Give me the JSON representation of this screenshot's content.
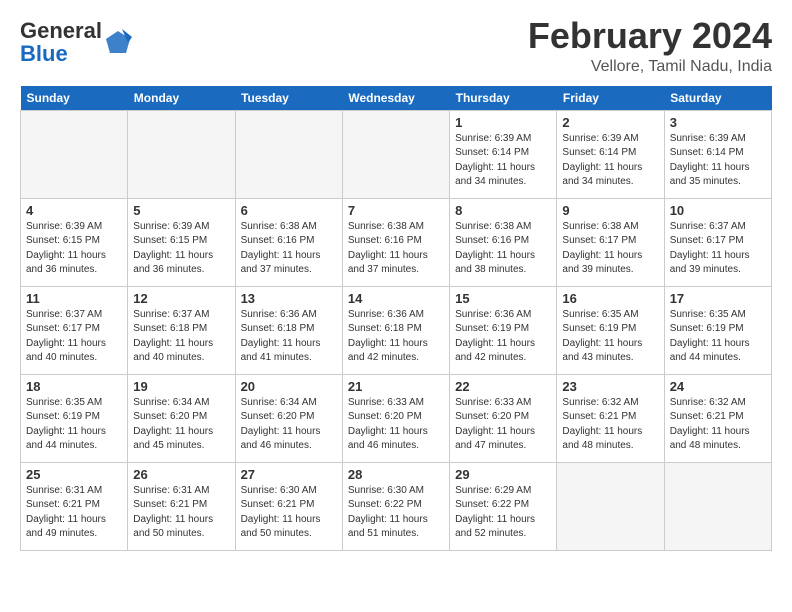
{
  "header": {
    "logo_general": "General",
    "logo_blue": "Blue",
    "title": "February 2024",
    "subtitle": "Vellore, Tamil Nadu, India"
  },
  "calendar": {
    "days_of_week": [
      "Sunday",
      "Monday",
      "Tuesday",
      "Wednesday",
      "Thursday",
      "Friday",
      "Saturday"
    ],
    "weeks": [
      [
        {
          "day": "",
          "info": ""
        },
        {
          "day": "",
          "info": ""
        },
        {
          "day": "",
          "info": ""
        },
        {
          "day": "",
          "info": ""
        },
        {
          "day": "1",
          "info": "Sunrise: 6:39 AM\nSunset: 6:14 PM\nDaylight: 11 hours\nand 34 minutes."
        },
        {
          "day": "2",
          "info": "Sunrise: 6:39 AM\nSunset: 6:14 PM\nDaylight: 11 hours\nand 34 minutes."
        },
        {
          "day": "3",
          "info": "Sunrise: 6:39 AM\nSunset: 6:14 PM\nDaylight: 11 hours\nand 35 minutes."
        }
      ],
      [
        {
          "day": "4",
          "info": "Sunrise: 6:39 AM\nSunset: 6:15 PM\nDaylight: 11 hours\nand 36 minutes."
        },
        {
          "day": "5",
          "info": "Sunrise: 6:39 AM\nSunset: 6:15 PM\nDaylight: 11 hours\nand 36 minutes."
        },
        {
          "day": "6",
          "info": "Sunrise: 6:38 AM\nSunset: 6:16 PM\nDaylight: 11 hours\nand 37 minutes."
        },
        {
          "day": "7",
          "info": "Sunrise: 6:38 AM\nSunset: 6:16 PM\nDaylight: 11 hours\nand 37 minutes."
        },
        {
          "day": "8",
          "info": "Sunrise: 6:38 AM\nSunset: 6:16 PM\nDaylight: 11 hours\nand 38 minutes."
        },
        {
          "day": "9",
          "info": "Sunrise: 6:38 AM\nSunset: 6:17 PM\nDaylight: 11 hours\nand 39 minutes."
        },
        {
          "day": "10",
          "info": "Sunrise: 6:37 AM\nSunset: 6:17 PM\nDaylight: 11 hours\nand 39 minutes."
        }
      ],
      [
        {
          "day": "11",
          "info": "Sunrise: 6:37 AM\nSunset: 6:17 PM\nDaylight: 11 hours\nand 40 minutes."
        },
        {
          "day": "12",
          "info": "Sunrise: 6:37 AM\nSunset: 6:18 PM\nDaylight: 11 hours\nand 40 minutes."
        },
        {
          "day": "13",
          "info": "Sunrise: 6:36 AM\nSunset: 6:18 PM\nDaylight: 11 hours\nand 41 minutes."
        },
        {
          "day": "14",
          "info": "Sunrise: 6:36 AM\nSunset: 6:18 PM\nDaylight: 11 hours\nand 42 minutes."
        },
        {
          "day": "15",
          "info": "Sunrise: 6:36 AM\nSunset: 6:19 PM\nDaylight: 11 hours\nand 42 minutes."
        },
        {
          "day": "16",
          "info": "Sunrise: 6:35 AM\nSunset: 6:19 PM\nDaylight: 11 hours\nand 43 minutes."
        },
        {
          "day": "17",
          "info": "Sunrise: 6:35 AM\nSunset: 6:19 PM\nDaylight: 11 hours\nand 44 minutes."
        }
      ],
      [
        {
          "day": "18",
          "info": "Sunrise: 6:35 AM\nSunset: 6:19 PM\nDaylight: 11 hours\nand 44 minutes."
        },
        {
          "day": "19",
          "info": "Sunrise: 6:34 AM\nSunset: 6:20 PM\nDaylight: 11 hours\nand 45 minutes."
        },
        {
          "day": "20",
          "info": "Sunrise: 6:34 AM\nSunset: 6:20 PM\nDaylight: 11 hours\nand 46 minutes."
        },
        {
          "day": "21",
          "info": "Sunrise: 6:33 AM\nSunset: 6:20 PM\nDaylight: 11 hours\nand 46 minutes."
        },
        {
          "day": "22",
          "info": "Sunrise: 6:33 AM\nSunset: 6:20 PM\nDaylight: 11 hours\nand 47 minutes."
        },
        {
          "day": "23",
          "info": "Sunrise: 6:32 AM\nSunset: 6:21 PM\nDaylight: 11 hours\nand 48 minutes."
        },
        {
          "day": "24",
          "info": "Sunrise: 6:32 AM\nSunset: 6:21 PM\nDaylight: 11 hours\nand 48 minutes."
        }
      ],
      [
        {
          "day": "25",
          "info": "Sunrise: 6:31 AM\nSunset: 6:21 PM\nDaylight: 11 hours\nand 49 minutes."
        },
        {
          "day": "26",
          "info": "Sunrise: 6:31 AM\nSunset: 6:21 PM\nDaylight: 11 hours\nand 50 minutes."
        },
        {
          "day": "27",
          "info": "Sunrise: 6:30 AM\nSunset: 6:21 PM\nDaylight: 11 hours\nand 50 minutes."
        },
        {
          "day": "28",
          "info": "Sunrise: 6:30 AM\nSunset: 6:22 PM\nDaylight: 11 hours\nand 51 minutes."
        },
        {
          "day": "29",
          "info": "Sunrise: 6:29 AM\nSunset: 6:22 PM\nDaylight: 11 hours\nand 52 minutes."
        },
        {
          "day": "",
          "info": ""
        },
        {
          "day": "",
          "info": ""
        }
      ]
    ]
  }
}
